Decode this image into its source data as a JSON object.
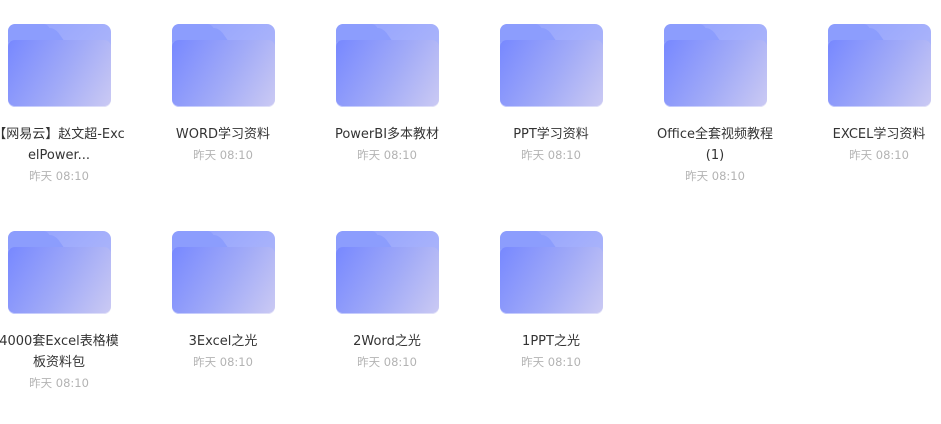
{
  "files": [
    {
      "name": "【网易云】赵文超-ExcelPower...",
      "time": "昨天 08:10"
    },
    {
      "name": "WORD学习资料",
      "time": "昨天 08:10"
    },
    {
      "name": "PowerBI多本教材",
      "time": "昨天 08:10"
    },
    {
      "name": "PPT学习资料",
      "time": "昨天 08:10"
    },
    {
      "name": "Office全套视频教程(1)",
      "time": "昨天 08:10"
    },
    {
      "name": "EXCEL学习资料",
      "time": "昨天 08:10"
    },
    {
      "name": "4000套Excel表格模板资料包",
      "time": "昨天 08:10"
    },
    {
      "name": "3Excel之光",
      "time": "昨天 08:10"
    },
    {
      "name": "2Word之光",
      "time": "昨天 08:10"
    },
    {
      "name": "1PPT之光",
      "time": "昨天 08:10"
    }
  ]
}
